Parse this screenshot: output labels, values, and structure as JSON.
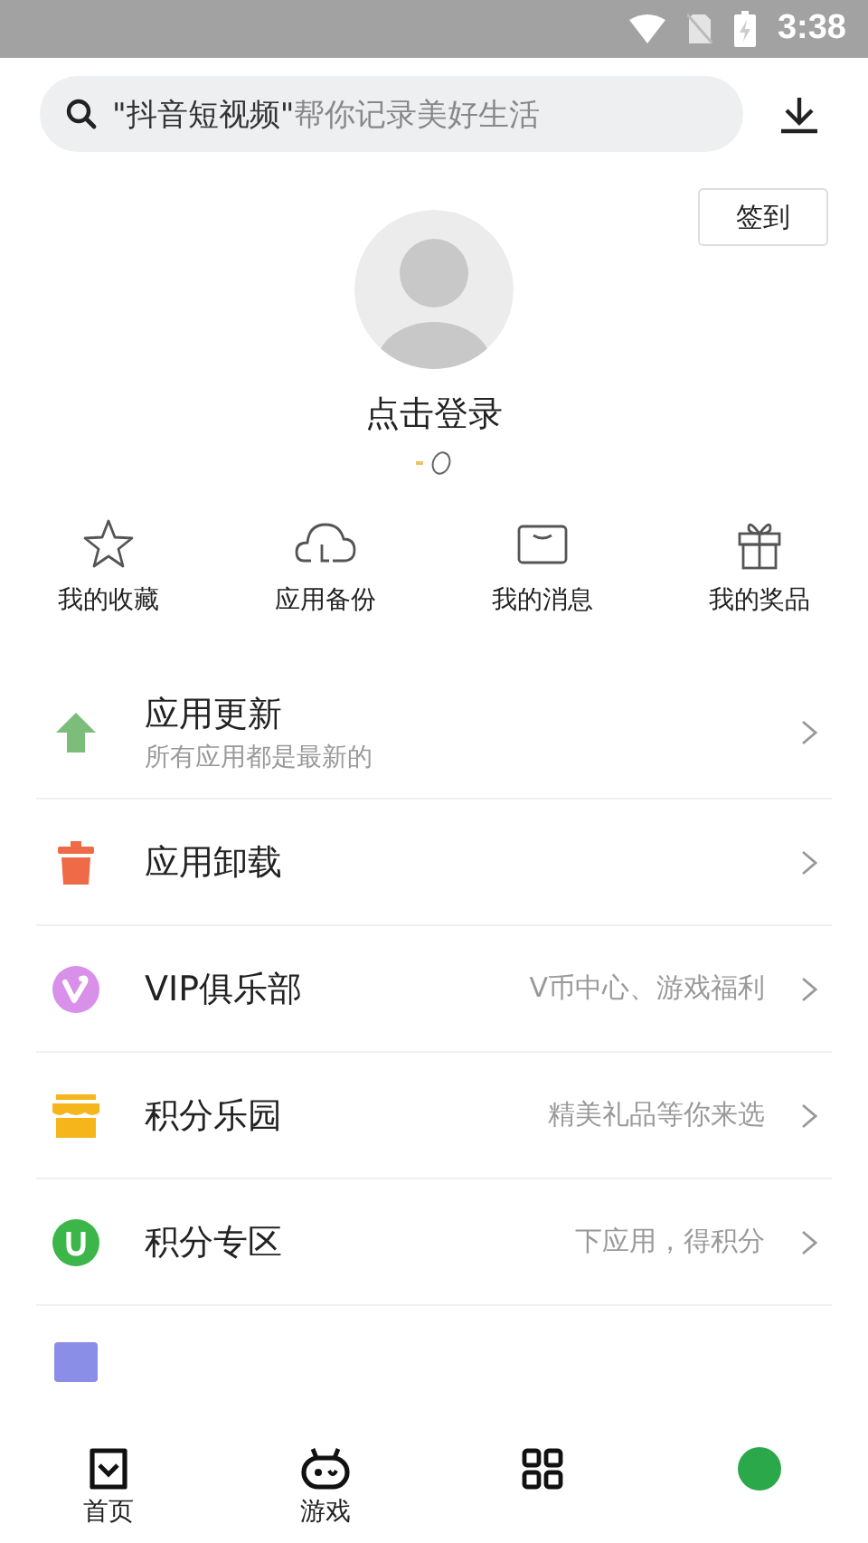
{
  "status_bar": {
    "time": "3:38"
  },
  "search": {
    "placeholder": "**\"抖音短视频\"**帮你记录美好生活"
  },
  "check_in_button": "签到",
  "profile": {
    "login_prompt": "点击登录"
  },
  "shortcuts": [
    {
      "label": "我的收藏"
    },
    {
      "label": "应用备份"
    },
    {
      "label": "我的消息"
    },
    {
      "label": "我的奖品"
    }
  ],
  "menu": [
    {
      "title": "应用更新",
      "subtitle": "所有应用都是最新的"
    },
    {
      "title": "应用卸载"
    },
    {
      "title": "VIP俱乐部",
      "hint": "V币中心、游戏福利"
    },
    {
      "title": "积分乐园",
      "hint": "精美礼品等你来选"
    },
    {
      "title": "积分专区",
      "hint": "下应用，得积分"
    }
  ],
  "bottom_nav": [
    {
      "label": "首页"
    },
    {
      "label": "游戏"
    }
  ]
}
